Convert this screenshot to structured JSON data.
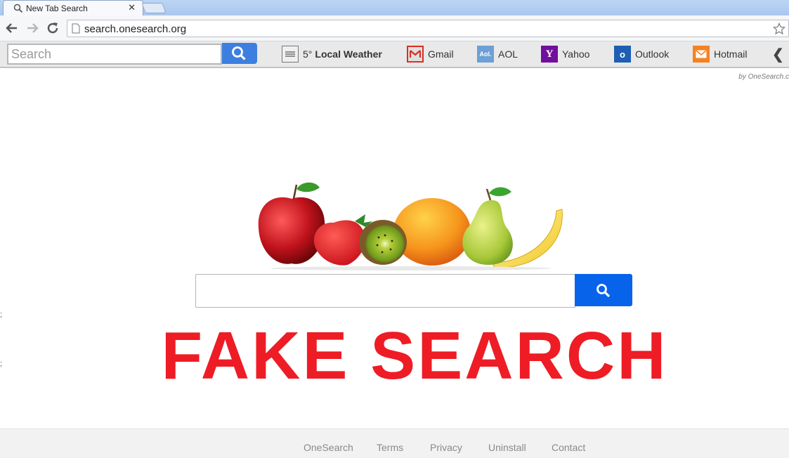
{
  "browser": {
    "tab_title": "New Tab Search",
    "tab_close": "✕",
    "url": "search.onesearch.org"
  },
  "toolbar": {
    "search_placeholder": "Search",
    "weather": {
      "temp": "5°",
      "label": "Local Weather"
    },
    "links": [
      {
        "label": "Gmail",
        "icon": "gmail-icon",
        "color": "#d93025"
      },
      {
        "label": "AOL",
        "icon": "aol-icon",
        "icon_text": "Aol.",
        "color": "#6e9fd6"
      },
      {
        "label": "Yahoo",
        "icon": "yahoo-icon",
        "icon_text": "Y",
        "color": "#720e9e"
      },
      {
        "label": "Outlook",
        "icon": "outlook-icon",
        "icon_text": "o",
        "color": "#1e5fb4"
      },
      {
        "label": "Hotmail",
        "icon": "hotmail-icon",
        "color": "#f58220"
      }
    ],
    "collapse": "❮"
  },
  "byline": "by OneSearch.c",
  "main": {
    "banner": "FAKE SEARCH",
    "banner_color": "#ee1c25",
    "search_button_color": "#0863eb"
  },
  "footer": {
    "links": [
      "OneSearch",
      "Terms",
      "Privacy",
      "Uninstall",
      "Contact"
    ]
  },
  "stray": [
    ";",
    ";"
  ]
}
